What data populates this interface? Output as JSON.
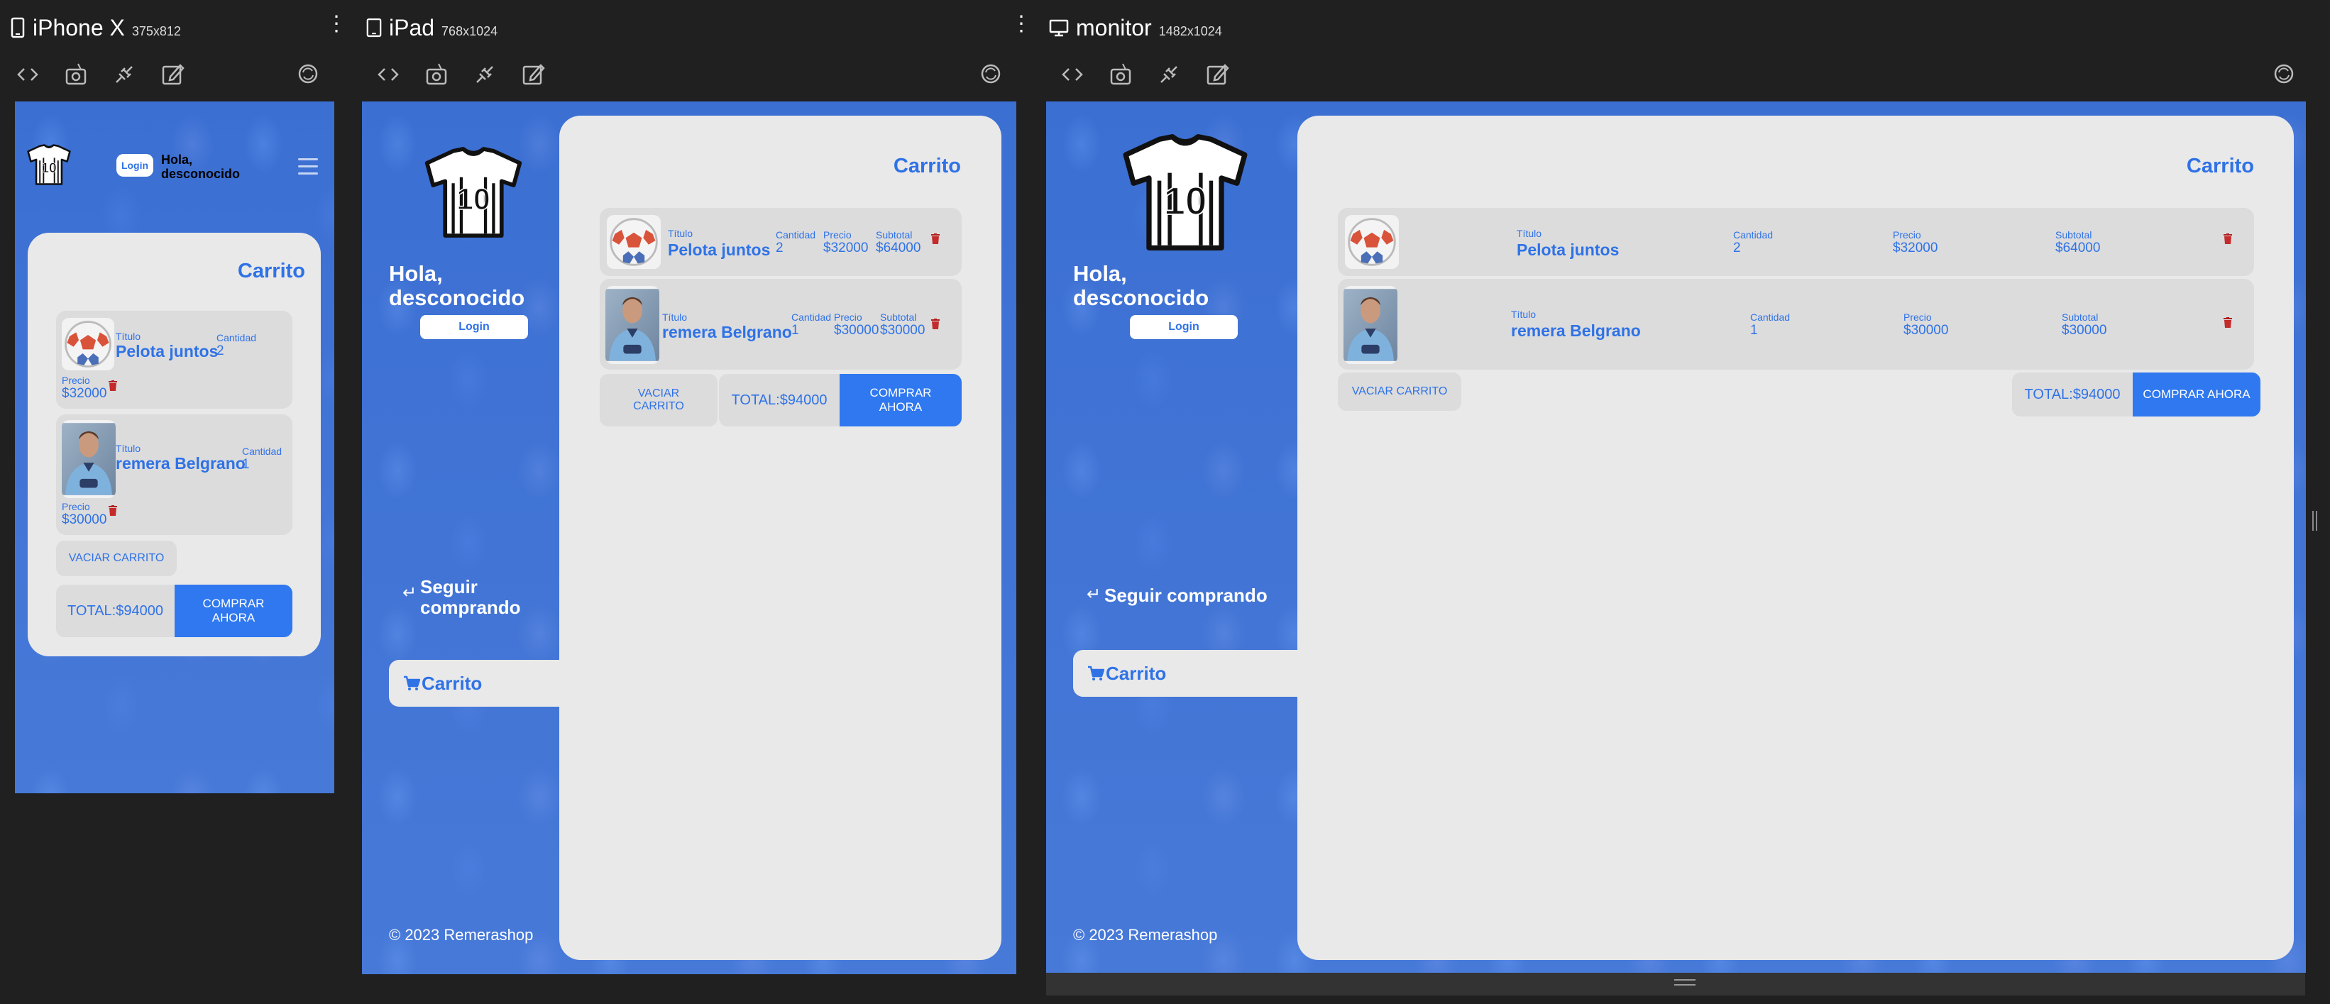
{
  "devices": {
    "iphone": {
      "name": "iPhone X",
      "size": "375x812"
    },
    "ipad": {
      "name": "iPad",
      "size": "768x1024"
    },
    "monitor": {
      "name": "monitor",
      "size": "1482x1024"
    }
  },
  "header": {
    "login_label": "Login",
    "greeting": "Hola, desconocido"
  },
  "sidebar": {
    "greeting": "Hola, desconocido",
    "login_label": "Login",
    "continue_label": "Seguir comprando",
    "cart_label": "Carrito",
    "footer": "© 2023 Remerashop"
  },
  "cart": {
    "title": "Carrito",
    "columns": {
      "title": "Título",
      "quantity": "Cantidad",
      "price": "Precio",
      "subtotal": "Subtotal"
    },
    "items": [
      {
        "name": "Pelota juntos",
        "quantity": "2",
        "price": "$32000",
        "subtotal": "$64000",
        "image": "soccer-ball"
      },
      {
        "name": "remera Belgrano",
        "quantity": "1",
        "price": "$30000",
        "subtotal": "$30000",
        "image": "player-photo"
      }
    ],
    "clear_label": "VACIAR CARRITO",
    "total_label": "TOTAL:$94000",
    "buy_label": "COMPRAR AHORA"
  },
  "colors": {
    "accent": "#2f72e6",
    "background": "#3f72d4",
    "panel": "#e9e9ea",
    "item": "#dcdcdd",
    "chrome": "#202020"
  }
}
